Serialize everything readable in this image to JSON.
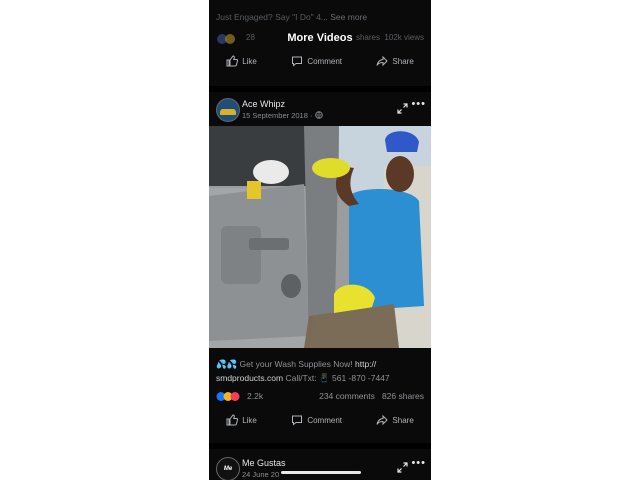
{
  "prev_post": {
    "snippet": "Just Engaged? Say \"I Do\" 4...",
    "see_more": "See more",
    "reaction_count": "28",
    "shares": "shares",
    "views": "102k views",
    "icons": [
      "like-reaction-icon",
      "love-reaction-icon"
    ]
  },
  "overlay": {
    "more_videos": "More Videos"
  },
  "actions": {
    "like": "Like",
    "comment": "Comment",
    "share": "Share"
  },
  "post": {
    "page_name": "Ace Whipz",
    "date": "15 September 2018 ·",
    "caption_emoji": "💦💦",
    "caption_text": "Get your Wash Supplies Now!",
    "caption_link_a": "http://",
    "caption_link_b": "smdproducts.com",
    "caption_call": "Call/Txt:",
    "caption_phone_icon": "📱",
    "caption_phone": "561 -870 -7447",
    "reaction_count": "2.2k",
    "comments": "234 comments",
    "shares": "826 shares"
  },
  "next_post": {
    "avatar_text": "Me Gustas",
    "page_name": "Me Gustas",
    "date": "24 June 20"
  },
  "colors": {
    "background": "#0a0a0a",
    "like_blue": "#1877f2",
    "love_red": "#f33e58",
    "haha_yellow": "#f7b125"
  }
}
